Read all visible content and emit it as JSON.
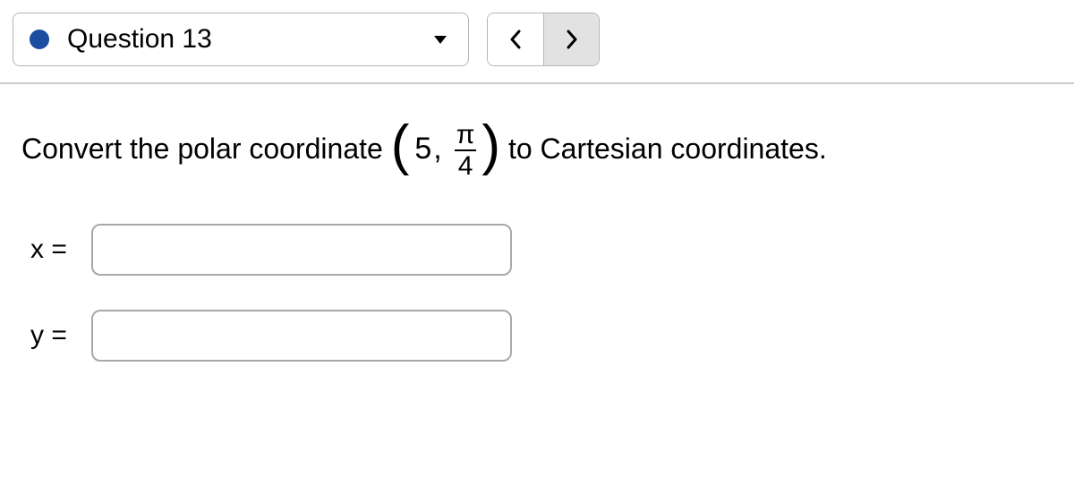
{
  "header": {
    "question_label": "Question 13"
  },
  "prompt": {
    "pre": "Convert the polar coordinate ",
    "r": "5",
    "comma": ",",
    "theta_num": "π",
    "theta_den": "4",
    "post": " to Cartesian coordinates."
  },
  "answers": {
    "x_label": "x =",
    "x_value": "",
    "y_label": "y =",
    "y_value": ""
  }
}
